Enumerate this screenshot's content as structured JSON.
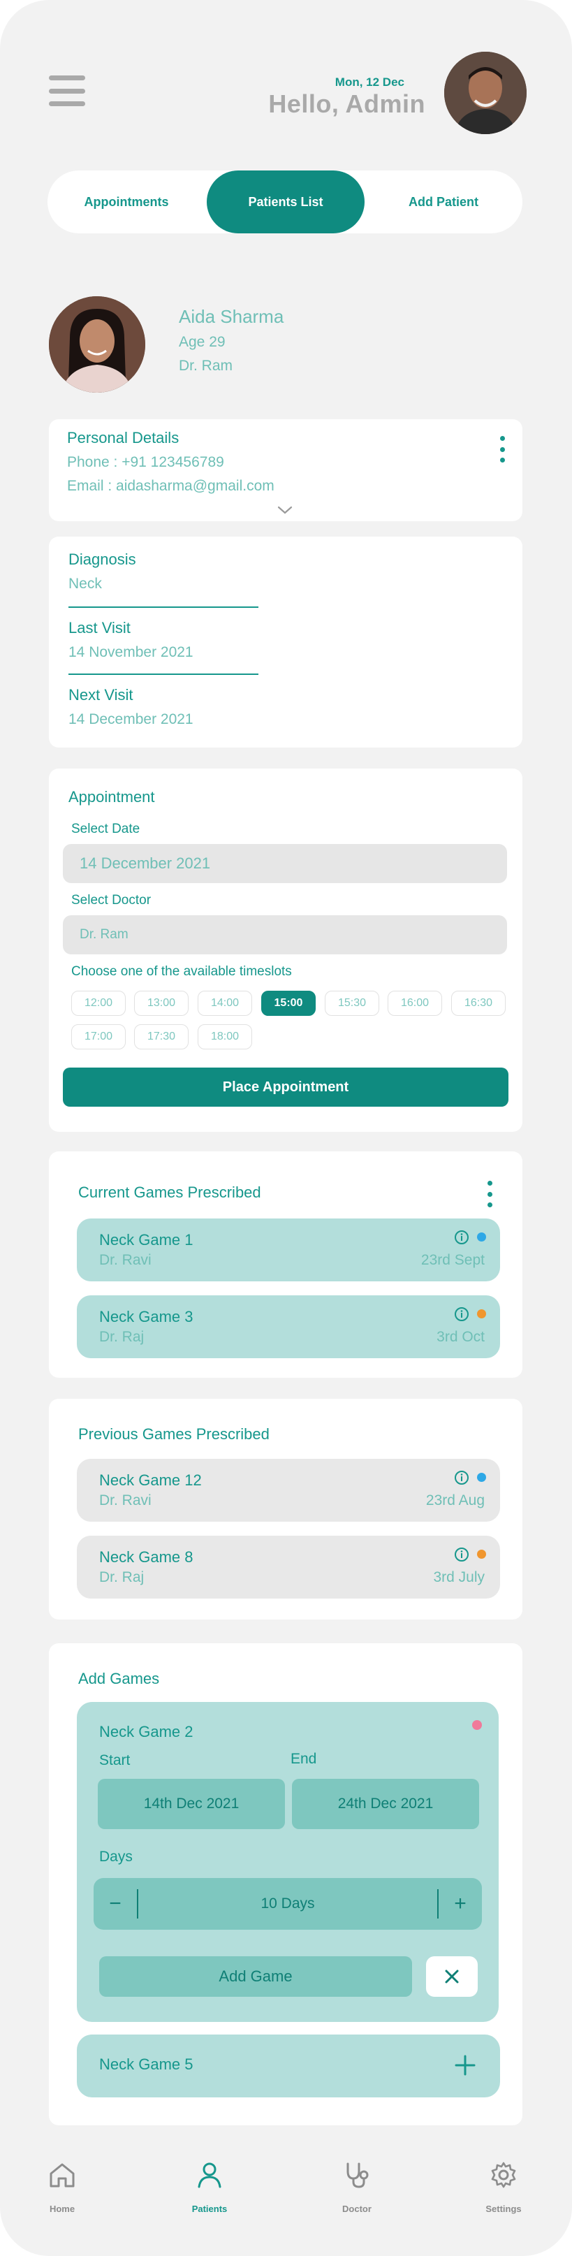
{
  "header": {
    "date": "Mon, 12 Dec",
    "greeting": "Hello, Admin"
  },
  "tabs": [
    {
      "label": "Appointments"
    },
    {
      "label": "Patients List"
    },
    {
      "label": "Add Patient"
    }
  ],
  "patient": {
    "name": "Aida Sharma",
    "age": "Age 29",
    "doctor": "Dr. Ram"
  },
  "personal": {
    "title": "Personal Details",
    "phone": "Phone : +91 123456789",
    "email": "Email : aidasharma@gmail.com"
  },
  "diagnosis": {
    "diagnosis_label": "Diagnosis",
    "diagnosis_value": "Neck",
    "last_label": "Last Visit",
    "last_value": "14 November 2021",
    "next_label": "Next Visit",
    "next_value": "14 December 2021"
  },
  "appointment": {
    "title": "Appointment",
    "date_label": "Select Date",
    "date_value": "14 December 2021",
    "doctor_label": "Select Doctor",
    "doctor_value": "Dr. Ram",
    "slots_label": "Choose one of the available timeslots",
    "slots": [
      "12:00",
      "13:00",
      "14:00",
      "15:00",
      "15:30",
      "16:00",
      "16:30",
      "17:00",
      "17:30",
      "18:00"
    ],
    "selected_slot": "15:00",
    "button": "Place Appointment"
  },
  "current_games": {
    "title": "Current Games Prescribed",
    "items": [
      {
        "name": "Neck Game 1",
        "doctor": "Dr. Ravi",
        "date": "23rd Sept",
        "dot": "#2ea8e6"
      },
      {
        "name": "Neck Game 3",
        "doctor": "Dr. Raj",
        "date": "3rd Oct",
        "dot": "#f0962e"
      }
    ]
  },
  "previous_games": {
    "title": "Previous Games Prescribed",
    "items": [
      {
        "name": "Neck Game 12",
        "doctor": "Dr. Ravi",
        "date": "23rd Aug",
        "dot": "#2ea8e6"
      },
      {
        "name": "Neck Game 8",
        "doctor": "Dr. Raj",
        "date": "3rd July",
        "dot": "#f0962e"
      }
    ]
  },
  "add_games": {
    "title": "Add Games",
    "game_name": "Neck Game 2",
    "dot": "#f07a9a",
    "start_label": "Start",
    "end_label": "End",
    "start_value": "14th Dec 2021",
    "end_value": "24th Dec 2021",
    "days_label": "Days",
    "days_value": "10 Days",
    "minus": "−",
    "plus": "+",
    "add_button": "Add Game",
    "next_game": "Neck Game 5"
  },
  "nav": [
    {
      "label": "Home",
      "icon": "home-icon"
    },
    {
      "label": "Patients",
      "icon": "user-icon"
    },
    {
      "label": "Doctor",
      "icon": "stethoscope-icon"
    },
    {
      "label": "Settings",
      "icon": "gear-icon"
    }
  ],
  "colors": {
    "primary": "#0f8b80",
    "text_teal": "#16978c",
    "light_teal": "#6fbfb6",
    "card_teal": "#b3dedb",
    "background": "#f2f2f2"
  }
}
